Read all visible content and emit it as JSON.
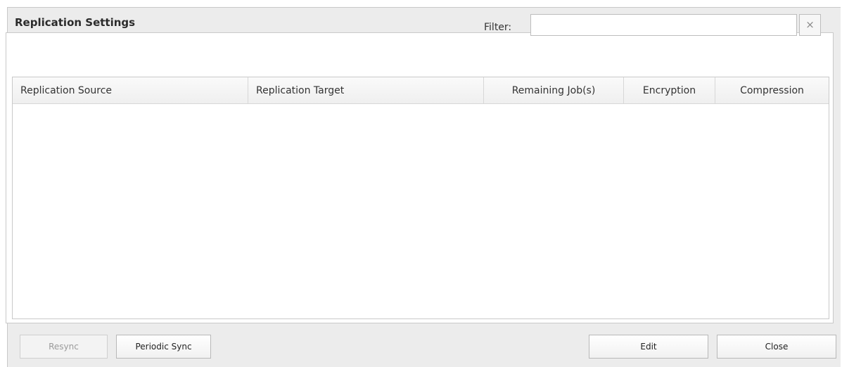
{
  "dialog": {
    "title": "Replication Settings"
  },
  "filter": {
    "label": "Filter:",
    "value": "",
    "placeholder": "",
    "clear_glyph": "×"
  },
  "table": {
    "columns": [
      "Replication Source",
      "Replication Target",
      "Remaining Job(s)",
      "Encryption",
      "Compression"
    ],
    "rows": []
  },
  "buttons": {
    "resync": "Resync",
    "periodic_sync": "Periodic Sync",
    "edit": "Edit",
    "close": "Close"
  },
  "icons": {
    "clear_filter": "close-icon"
  }
}
